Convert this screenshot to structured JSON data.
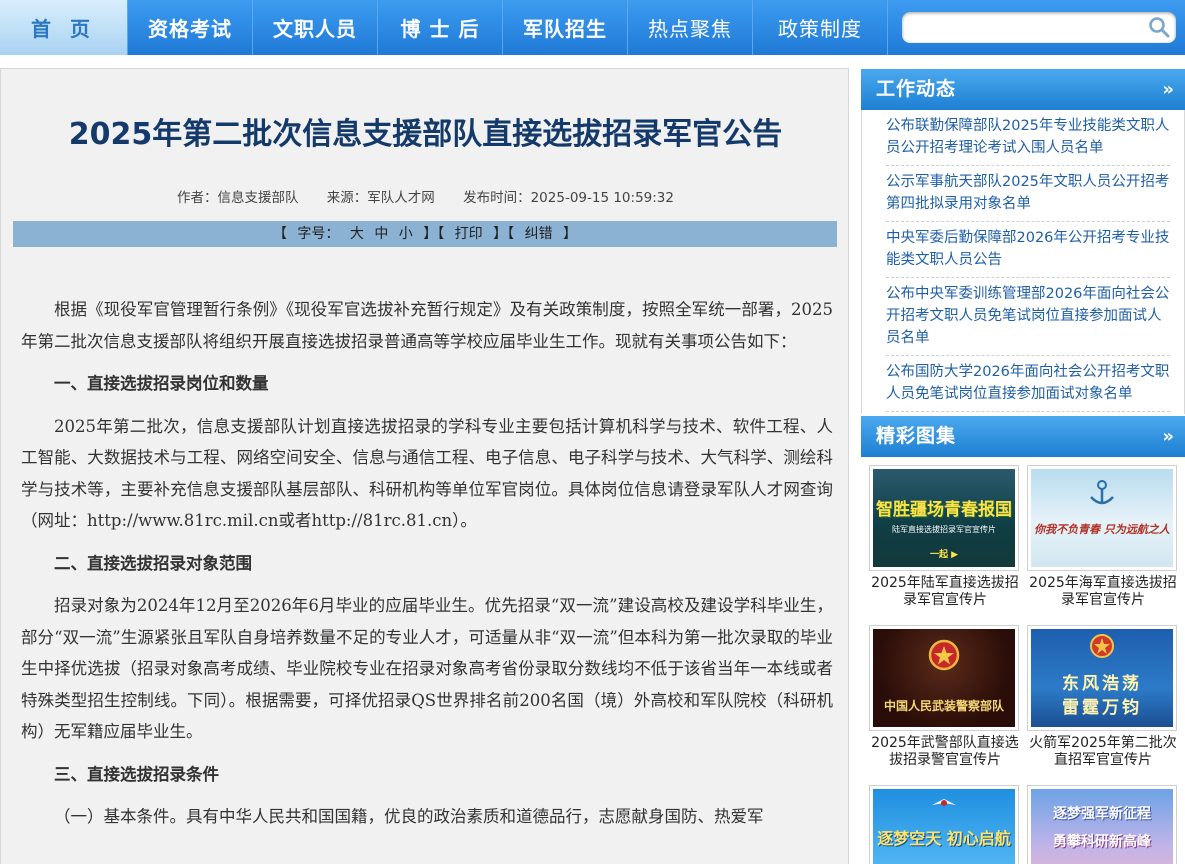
{
  "nav": {
    "items": [
      {
        "label": "首 页",
        "active": true
      },
      {
        "label": "资格考试"
      },
      {
        "label": "文职人员"
      },
      {
        "label": "博 士 后"
      },
      {
        "label": "军队招生"
      },
      {
        "label": "热点聚焦"
      },
      {
        "label": "政策制度"
      }
    ],
    "search_placeholder": ""
  },
  "article": {
    "title": "2025年第二批次信息支援部队直接选拔招录军官公告",
    "author": "作者：信息支援部队",
    "source": "来源：军队人才网",
    "published": "发布时间：2025-09-15 10:59:32",
    "toolbar": {
      "open": "【",
      "font_label": "字号：",
      "large": "大",
      "medium": "中",
      "small": "小",
      "close1": "】【",
      "print": "打印",
      "close2": "】【",
      "correct": "纠错",
      "close3": "】"
    },
    "paragraphs": {
      "intro": "根据《现役军官管理暂行条例》《现役军官选拔补充暂行规定》及有关政策制度，按照全军统一部署，2025年第二批次信息支援部队将组织开展直接选拔招录普通高等学校应届毕业生工作。现就有关事项公告如下：",
      "h1": "一、直接选拔招录岗位和数量",
      "p1": "2025年第二批次，信息支援部队计划直接选拔招录的学科专业主要包括计算机科学与技术、软件工程、人工智能、大数据技术与工程、网络空间安全、信息与通信工程、电子信息、电子科学与技术、大气科学、测绘科学与技术等，主要补充信息支援部队基层部队、科研机构等单位军官岗位。具体岗位信息请登录军队人才网查询（网址：http://www.81rc.mil.cn或者http://81rc.81.cn）。",
      "h2": "二、直接选拔招录对象范围",
      "p2": "招录对象为2024年12月至2026年6月毕业的应届毕业生。优先招录“双一流”建设高校及建设学科毕业生，部分“双一流”生源紧张且军队自身培养数量不足的专业人才，可适量从非“双一流”但本科为第一批次录取的毕业生中择优选拔（招录对象高考成绩、毕业院校专业在招录对象高考省份录取分数线均不低于该省当年一本线或者特殊类型招生控制线。下同）。根据需要，可择优招录QS世界排名前200名国（境）外高校和军队院校（科研机构）无军籍应届毕业生。",
      "h3": "三、直接选拔招录条件",
      "p3": "（一）基本条件。具有中华人民共和国国籍，优良的政治素质和道德品行，志愿献身国防、热爱军"
    }
  },
  "sidebar": {
    "news_title": "工作动态",
    "news_more": "»",
    "news": [
      "公布联勤保障部队2025年专业技能类文职人员公开招考理论考试入围人员名单",
      "公示军事航天部队2025年文职人员公开招考第四批拟录用对象名单",
      "中央军委后勤保障部2026年公开招考专业技能类文职人员公告",
      "公布中央军委训练管理部2026年面向社会公开招考文职人员免笔试岗位直接参加面试人员名单",
      "公布国防大学2026年面向社会公开招考文职人员免笔试岗位直接参加面试对象名单"
    ],
    "gallery_title": "精彩图集",
    "gallery_more": "»",
    "gallery": [
      {
        "caption": "2025年陆军直接选拔招录军官宣传片",
        "banner": "智胜疆场青春报国",
        "sub": "陆军直接选拔招录军官宣传片",
        "tag": "一起 ▶"
      },
      {
        "caption": "2025年海军直接选拔招录军官宣传片",
        "banner": "你我不负青春 只为远航之人"
      },
      {
        "caption": "2025年武警部队直接选拔招录警官宣传片",
        "banner": "中国人民武装警察部队"
      },
      {
        "caption": "火箭军2025年第二批次直招军官宣传片",
        "banner": "东风浩荡",
        "banner2": "雷霆万钧"
      },
      {
        "caption": "",
        "banner": "逐梦空天 初心启航"
      },
      {
        "caption": "",
        "banner": "逐梦强军新征程",
        "banner2": "勇攀科研新高峰"
      }
    ]
  }
}
